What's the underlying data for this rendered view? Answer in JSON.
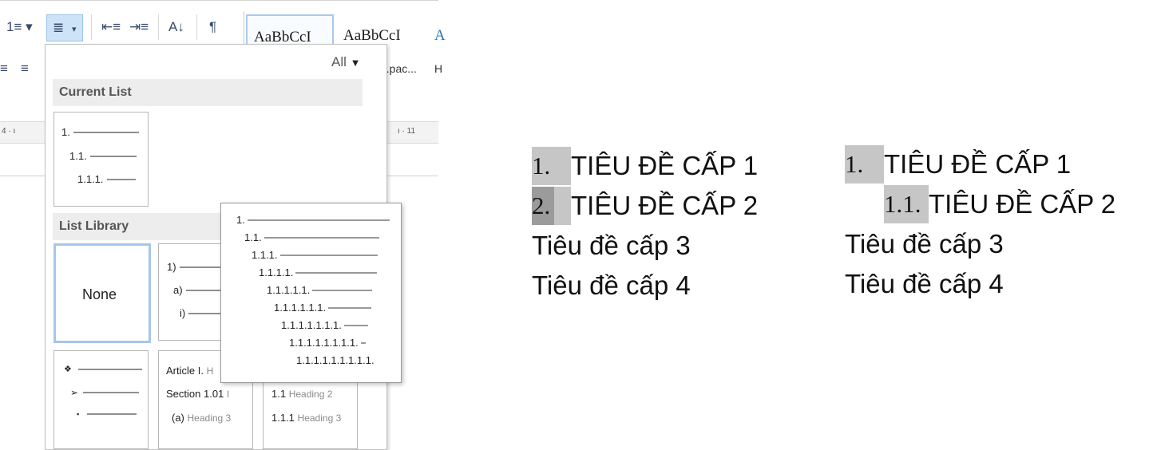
{
  "ribbon": {
    "numbering_icon": "1≡",
    "multilevel_icon": "≣",
    "decrease_indent_icon": "⇤≡",
    "increase_indent_icon": "⇥≡",
    "sort_icon": "A↓",
    "pilcrow_icon": "¶",
    "align_icon": "≡",
    "styles": [
      {
        "label": "AaBbCcI",
        "sub": "...pac..."
      },
      {
        "label": "AaBbCcI",
        "sub": ""
      },
      {
        "label": "A",
        "sub": "H"
      }
    ],
    "ruler_left": "4 · ı",
    "ruler_right": "ı · 11"
  },
  "dropdown": {
    "filter_label": "All",
    "current_list": {
      "header": "Current List",
      "levels": [
        "1.",
        "1.1.",
        "1.1.1."
      ]
    },
    "list_library": {
      "header": "List Library",
      "none_label": "None",
      "paren_levels": [
        "1)",
        "a)",
        "i)"
      ],
      "bullet_levels": [
        "❖",
        "➢",
        "▪"
      ],
      "article": [
        "Article I.",
        "Section 1.01",
        "(a)"
      ],
      "article_suffix": [
        "H",
        "I",
        "Heading 3"
      ],
      "heading": [
        "1.1",
        "1.1.1"
      ],
      "heading_suffix": [
        "Heading 2",
        "Heading 3"
      ]
    }
  },
  "preview": {
    "levels": [
      "1.",
      "1.1.",
      "1.1.1.",
      "1.1.1.1.",
      "1.1.1.1.1.",
      "1.1.1.1.1.1.",
      "1.1.1.1.1.1.1.",
      "1.1.1.1.1.1.1.1.",
      "1.1.1.1.1.1.1.1.1."
    ]
  },
  "document": {
    "left": {
      "lines": [
        {
          "number": "1.",
          "text": "TIÊU ĐỀ CẤP 1"
        },
        {
          "number": "2.",
          "text": "TIÊU ĐỀ CẤP 2"
        },
        {
          "number": "",
          "text": "Tiêu đề cấp 3"
        },
        {
          "number": "",
          "text": "Tiêu đề cấp 4"
        }
      ]
    },
    "right": {
      "lines": [
        {
          "number": "1.",
          "text": "TIÊU ĐỀ CẤP 1"
        },
        {
          "number": "1.1.",
          "text": "TIÊU ĐỀ CẤP 2"
        },
        {
          "number": "",
          "text": "Tiêu đề cấp 3"
        },
        {
          "number": "",
          "text": "Tiêu đề cấp 4"
        }
      ]
    }
  },
  "colors": {
    "selected_button": "#cde4f8",
    "number_highlight": "#c6c6c6",
    "number_highlight_dark": "#9b9b9b",
    "section_header_bg": "#ededed"
  }
}
